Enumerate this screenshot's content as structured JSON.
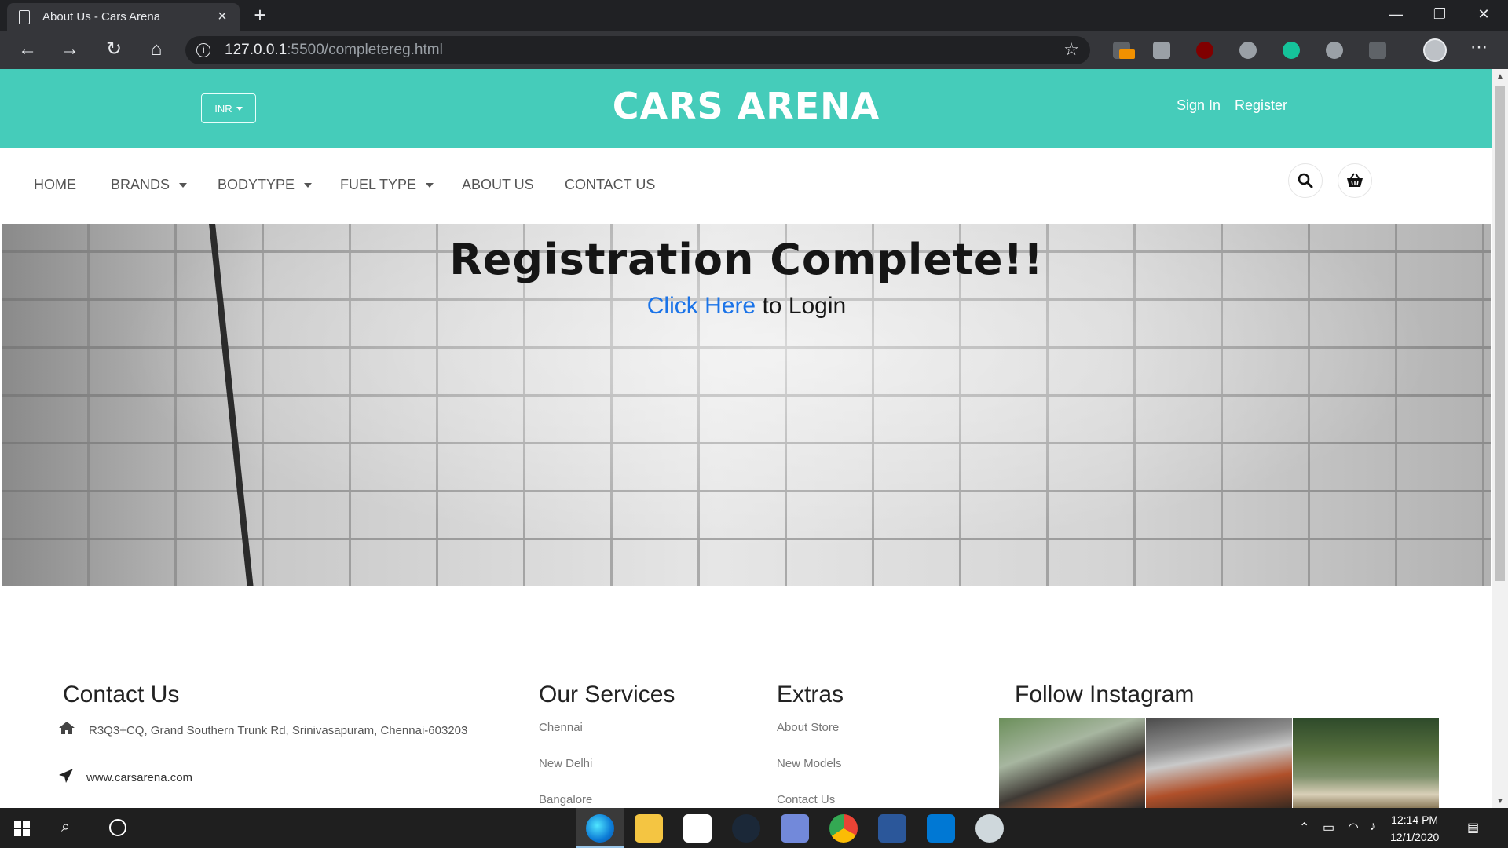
{
  "browser": {
    "tab_title": "About Us - Cars Arena",
    "url_host": "127.0.0.1",
    "url_path": ":5500/completereg.html"
  },
  "header": {
    "currency": "INR",
    "logo": "CARS ARENA",
    "sign_in": "Sign In",
    "register": "Register",
    "brand_color": "#45ccba"
  },
  "nav": {
    "home": "HOME",
    "brands": "BRANDS",
    "bodytype": "BODYTYPE",
    "fuel_type": "FUEL TYPE",
    "about": "ABOUT US",
    "contact": "CONTACT US"
  },
  "hero": {
    "title": "Registration Complete!!",
    "link_text": "Click Here",
    "suffix": " to Login"
  },
  "footer": {
    "contact": {
      "title": "Contact Us",
      "address": "R3Q3+CQ, Grand Southern Trunk Rd, Srinivasapuram, Chennai-603203",
      "website": "www.carsarena.com"
    },
    "services": {
      "title": "Our Services",
      "items": [
        "Chennai",
        "New Delhi",
        "Bangalore"
      ]
    },
    "extras": {
      "title": "Extras",
      "items": [
        "About Store",
        "New Models",
        "Contact Us"
      ]
    },
    "instagram": {
      "title": "Follow Instagram"
    }
  },
  "taskbar": {
    "time": "12:14 PM",
    "date": "12/1/2020"
  }
}
